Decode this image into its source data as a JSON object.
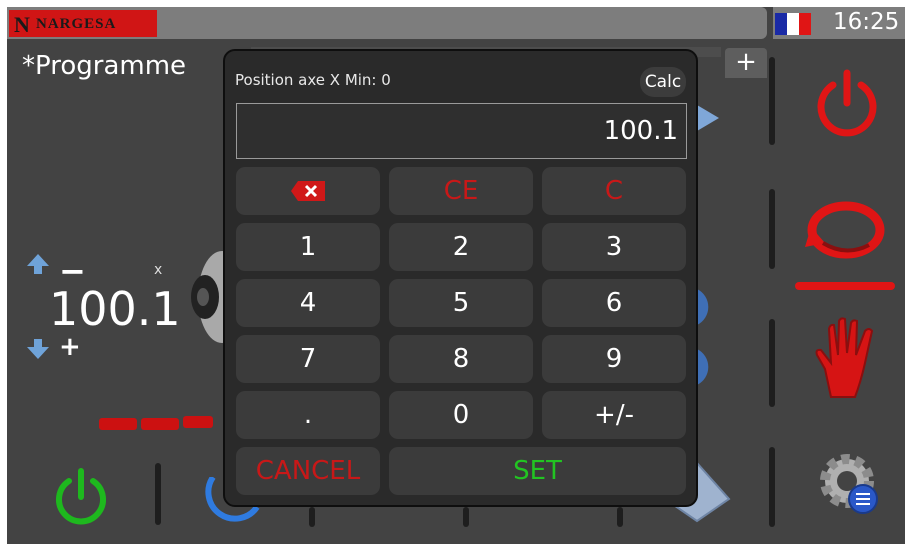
{
  "app": {
    "brand_mark": "N",
    "brand_text": "NARGESA",
    "clock": "16:25",
    "language_flag": "france-flag-icon"
  },
  "program": {
    "title": "*Programme",
    "add_tab_label": "+"
  },
  "axis": {
    "name": "x",
    "value": "100.1",
    "minus_label": "−",
    "plus_label": "+"
  },
  "dialog": {
    "title": "Position axe X Min: 0",
    "calc_label": "Calc",
    "display_value": "100.1",
    "keys": {
      "ce": "CE",
      "c": "C",
      "k1": "1",
      "k2": "2",
      "k3": "3",
      "k4": "4",
      "k5": "5",
      "k6": "6",
      "k7": "7",
      "k8": "8",
      "k9": "9",
      "dot": ".",
      "k0": "0",
      "sign": "+/-"
    },
    "cancel_label": "CANCEL",
    "set_label": "SET"
  },
  "colors": {
    "accent_red": "#e01515",
    "accent_green": "#22c422",
    "background": "#434343"
  }
}
